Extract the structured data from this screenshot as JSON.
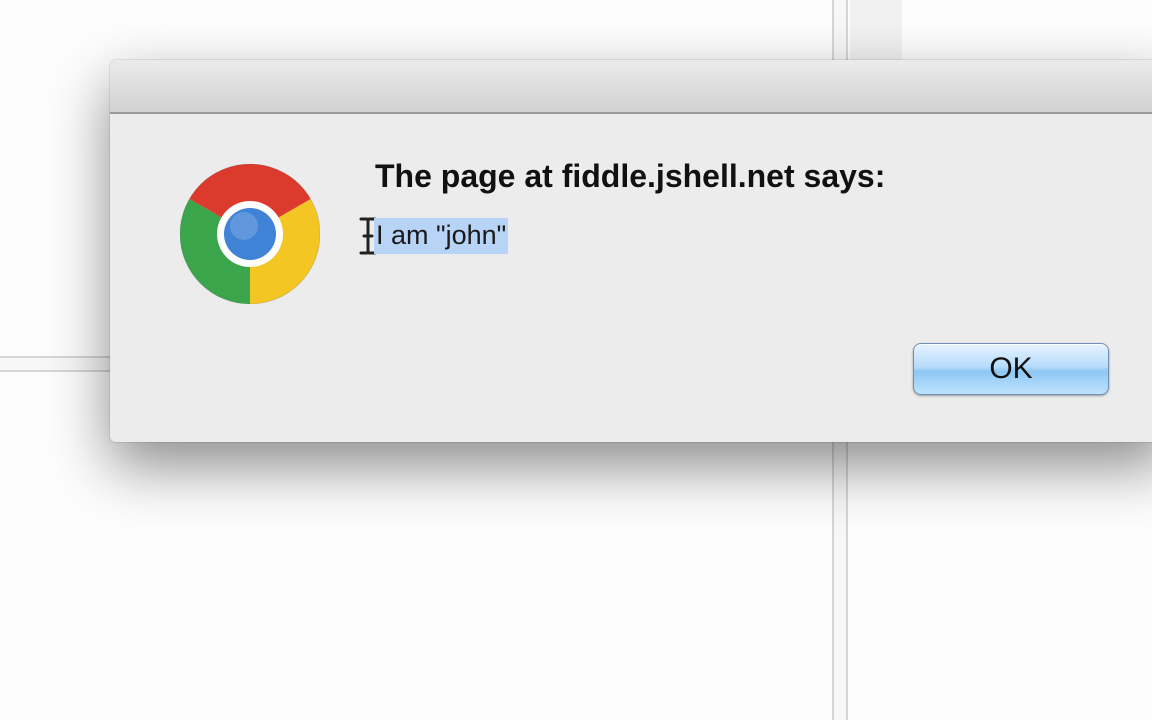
{
  "dialog": {
    "heading": "The page at fiddle.jshell.net says:",
    "message": "I am \"john\"",
    "ok_label": "OK",
    "app_icon": "chrome-logo-icon",
    "cursor_icon": "text-cursor-icon"
  },
  "colors": {
    "selection": "#b7d3f5",
    "dialog_background": "#ececec",
    "button_blue": "#8ec7f4"
  }
}
